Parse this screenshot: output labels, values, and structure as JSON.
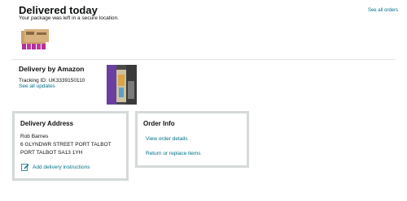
{
  "header": {
    "title": "Delivered today",
    "subtitle": "Your package was left in a secure location.",
    "see_all_orders": "See all orders"
  },
  "shipment": {
    "carrier": "Delivery by Amazon",
    "tracking": "Tracking ID: UK3339150110",
    "see_all_updates": "See all updates"
  },
  "address": {
    "title": "Delivery Address",
    "name": "Rob Barnes",
    "line1": "6 GLYNDWR STREET PORT TALBOT",
    "line2": "PORT TALBOT SA13 1YH",
    "add_instructions": "Add delivery instructions"
  },
  "order_info": {
    "title": "Order Info",
    "view_details": "View order details",
    "return_replace": "Return or replace items"
  },
  "colors": {
    "link": "#007185",
    "card_border": "#d5d9d9",
    "divider": "#e6e6e6"
  },
  "icons": {
    "edit": "edit-note-icon"
  }
}
